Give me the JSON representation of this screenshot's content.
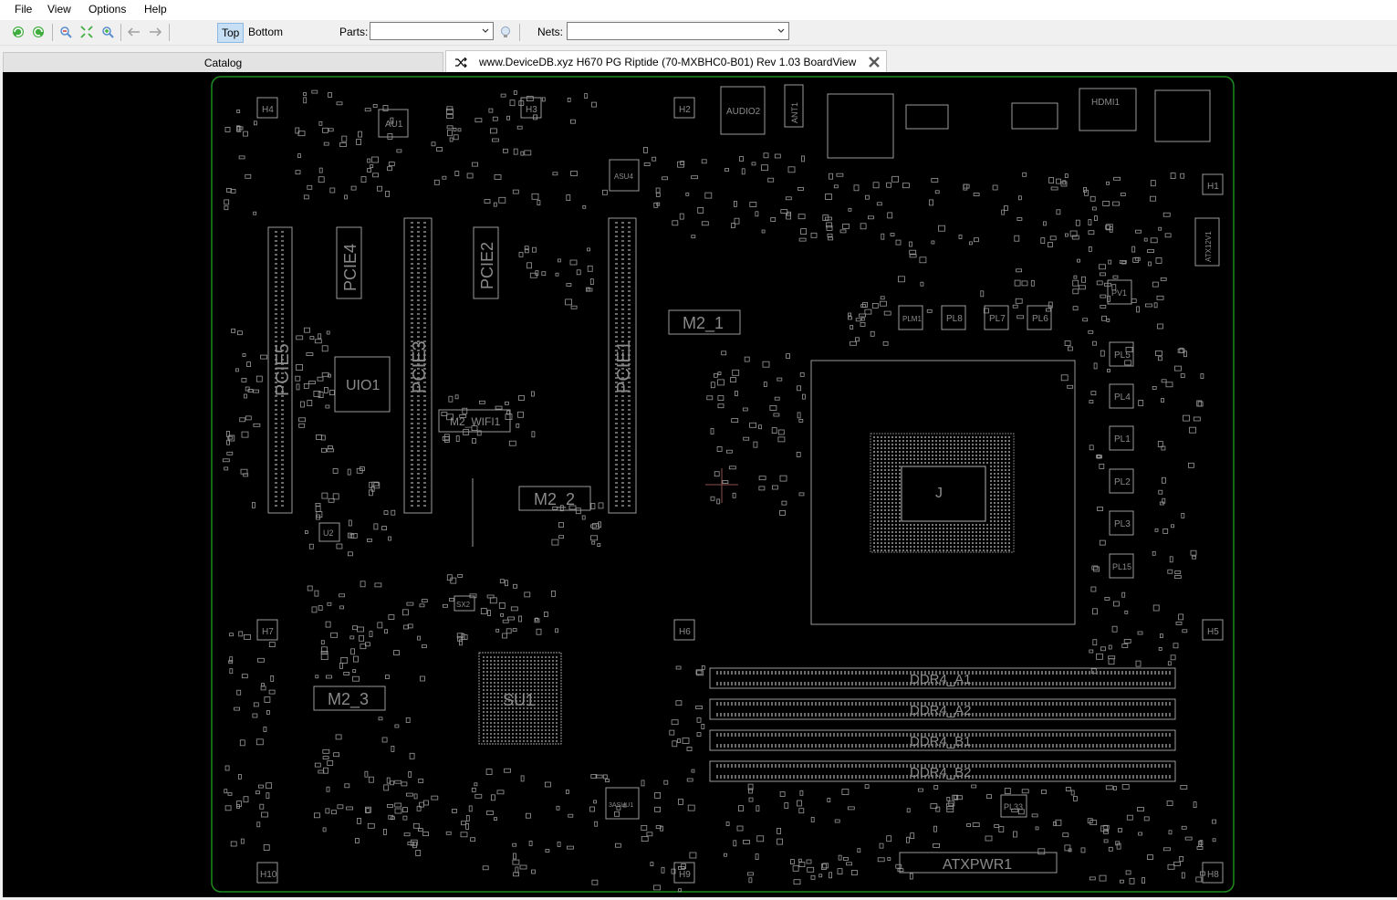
{
  "menu": {
    "file": "File",
    "view": "View",
    "options": "Options",
    "help": "Help"
  },
  "toolbar": {
    "top_label": "Top",
    "bottom_label": "Bottom",
    "parts_label": "Parts:",
    "parts_value": "",
    "nets_label": "Nets:",
    "nets_value": ""
  },
  "tabs": {
    "catalog": "Catalog",
    "board": "www.DeviceDB.xyz H670 PG Riptide (70-MXBHC0-B01) Rev 1.03 BoardView"
  },
  "board": {
    "outline_color": "#1e8c1e",
    "component_color": "#9a9a9a",
    "labels": {
      "au1": "AU1",
      "h4": "H4",
      "h3": "H3",
      "h2": "H2",
      "h1": "H1",
      "h5": "H5",
      "h6": "H6",
      "h7": "H7",
      "h8": "H8",
      "h9": "H9",
      "h10": "H10",
      "audio2": "AUDIO2",
      "ant1": "ANT1",
      "hdmi1": "HDMI1",
      "pcie5": "PCIE5",
      "pcie4": "PCIE4",
      "pcie3": "PCIE3",
      "pcie2": "PCIE2",
      "pcie1": "PCIE1",
      "uio1": "UIO1",
      "m2_wifi1": "M2_WIFI1",
      "m2_1": "M2_1",
      "m2_2": "M2_2",
      "m2_3": "M2_3",
      "asu4": "ASU4",
      "su1": "SU1",
      "u2": "U2",
      "sx2": "SX2",
      "au3u1": "3ASUU1",
      "plm1": "PLM1",
      "pl8": "PL8",
      "pl7": "PL7",
      "pl6": "PL6",
      "pl5": "PL5",
      "pl4": "PL4",
      "pl1": "PL1",
      "pl2": "PL2",
      "pl3": "PL3",
      "pl15": "PL15",
      "pl33": "PL33",
      "pv1": "PV1",
      "atx12v1": "ATX12V1",
      "ddr4_a1": "DDR4_A1",
      "ddr4_a2": "DDR4_A2",
      "ddr4_b1": "DDR4_B1",
      "ddr4_b2": "DDR4_B2",
      "atxpwr1": "ATXPWR1",
      "cpu": "J"
    }
  }
}
